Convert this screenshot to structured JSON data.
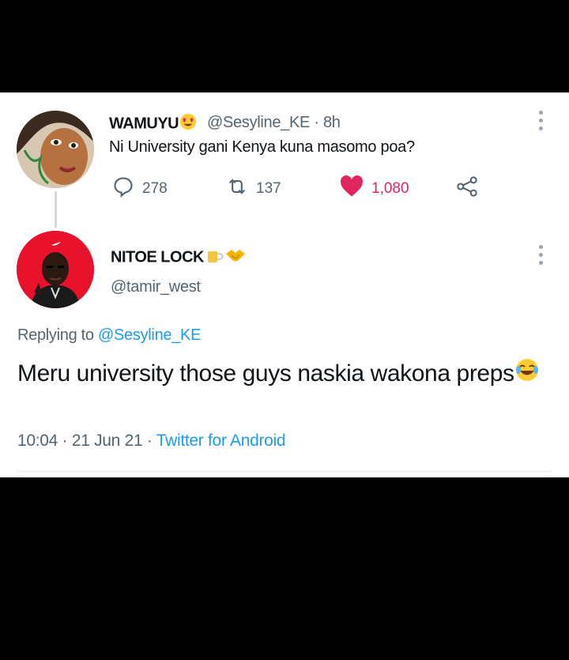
{
  "parent_tweet": {
    "name": "WAMUYU",
    "name_emoji": "heart-eyes-emoji",
    "handle": "@Sesyline_KE",
    "time": " · 8h",
    "text": "Ni University gani Kenya kuna masomo poa?",
    "replies": "278",
    "retweets": "137",
    "likes": "1,080",
    "colors": {
      "like": "#e0245e",
      "muted": "#536471"
    }
  },
  "reply_tweet": {
    "name": "NITOE LOCK",
    "name_emojis": [
      "beer-mug-emoji",
      "handshake-emoji"
    ],
    "handle": "@tamir_west",
    "replying_prefix": "Replying to ",
    "replying_handle": "@Sesyline_KE",
    "text": "Meru university those guys naskia wakona preps",
    "text_emoji": "tears-of-joy-emoji",
    "timestamp": "10:04 · 21 Jun 21 · ",
    "source": "Twitter for Android",
    "colors": {
      "link": "#1d9bf0"
    }
  }
}
